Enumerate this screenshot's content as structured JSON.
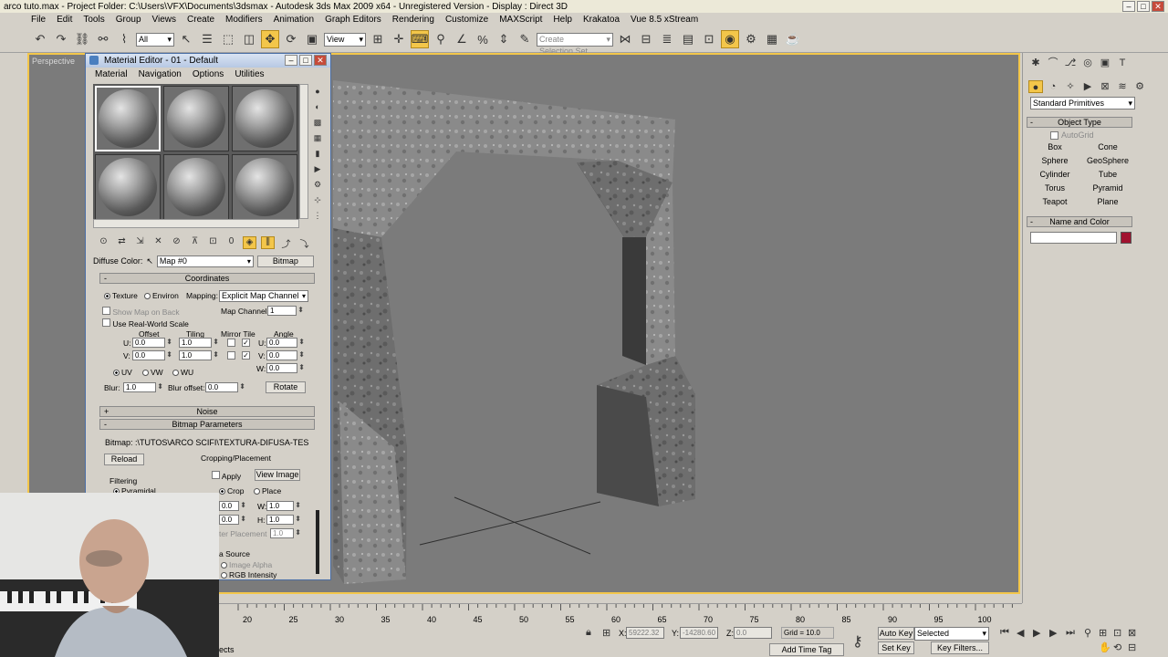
{
  "window": {
    "title": "arco tuto.max    - Project Folder: C:\\Users\\VFX\\Documents\\3dsmax    - Autodesk 3ds Max  2009 x64    - Unregistered Version    - Display : Direct 3D"
  },
  "menubar": [
    "File",
    "Edit",
    "Tools",
    "Group",
    "Views",
    "Create",
    "Modifiers",
    "Animation",
    "Graph Editors",
    "Rendering",
    "Customize",
    "MAXScript",
    "Help",
    "Krakatoa",
    "Vue 8.5 xStream"
  ],
  "toolbar": {
    "filter_select": "All",
    "view_select": "View",
    "selection_set_placeholder": "Create Selection Set"
  },
  "viewport": {
    "label": "Perspective"
  },
  "command_panel": {
    "category": "Standard Primitives",
    "object_type_header": "Object Type",
    "autogrid_label": "AutoGrid",
    "buttons": [
      "Box",
      "Cone",
      "Sphere",
      "GeoSphere",
      "Cylinder",
      "Tube",
      "Torus",
      "Pyramid",
      "Teapot",
      "Plane"
    ],
    "name_color_header": "Name and Color",
    "swatch_color": "#a1122f"
  },
  "material_editor": {
    "title": "Material Editor - 01 - Default",
    "menu": [
      "Material",
      "Navigation",
      "Options",
      "Utilities"
    ],
    "diffuse_label": "Diffuse Color:",
    "map_name": "Map #0",
    "map_type": "Bitmap",
    "coordinates": {
      "header": "Coordinates",
      "texture": "Texture",
      "environ": "Environ",
      "mapping_label": "Mapping:",
      "mapping_value": "Explicit Map Channel",
      "show_map_on_back": "Show Map on Back",
      "map_channel_label": "Map Channel:",
      "map_channel_value": "1",
      "real_world": "Use Real-World Scale",
      "col_offset": "Offset",
      "col_tiling": "Tiling",
      "col_mirror_tile": "Mirror Tile",
      "col_angle": "Angle",
      "u_label": "U:",
      "v_label": "V:",
      "w_label": "W:",
      "u_offset": "0.0",
      "v_offset": "0.0",
      "u_tiling": "1.0",
      "v_tiling": "1.0",
      "u_angle": "0.0",
      "v_angle": "0.0",
      "w_angle": "0.0",
      "uv": "UV",
      "vw": "VW",
      "wu": "WU",
      "blur_label": "Blur:",
      "blur_value": "1.0",
      "blur_offset_label": "Blur offset:",
      "blur_offset_value": "0.0",
      "rotate": "Rotate"
    },
    "noise_header": "Noise",
    "bitmap_params": {
      "header": "Bitmap Parameters",
      "bitmap_path": "Bitmap:  :\\TUTOS\\ARCO SCIFI\\TEXTURA-DIFUSA-TESTE.jpg",
      "reload": "Reload",
      "cropping_label": "Cropping/Placement",
      "apply": "Apply",
      "view_image": "View Image",
      "filtering_label": "Filtering",
      "pyramidal": "Pyramidal",
      "crop": "Crop",
      "place": "Place",
      "w_label": "W:",
      "h_label": "H:",
      "w_value": "1.0",
      "h_value": "1.0",
      "u_value": "0.0",
      "v_value": "0.0",
      "jitter_label": "ter Placement",
      "jitter_value": "1.0",
      "mono_source": "a Source",
      "image_alpha": "Image Alpha",
      "rgb_intensity": "RGB Intensity"
    }
  },
  "timeline": {
    "ticks": [
      "20",
      "25",
      "30",
      "35",
      "40",
      "45",
      "50",
      "55",
      "60",
      "65",
      "70",
      "75",
      "80",
      "85",
      "90",
      "95",
      "100"
    ]
  },
  "statusbar": {
    "x_label": "X:",
    "x_value": "59222.32",
    "y_label": "Y:",
    "y_value": "-14280.60",
    "z_label": "Z:",
    "z_value": "0.0",
    "grid": "Grid = 10.0",
    "auto_key": "Auto Key",
    "selected": "Selected",
    "set_key": "Set Key",
    "key_filters": "Key Filters...",
    "add_time_tag": "Add Time Tag",
    "prompt_fragment": "ects"
  }
}
